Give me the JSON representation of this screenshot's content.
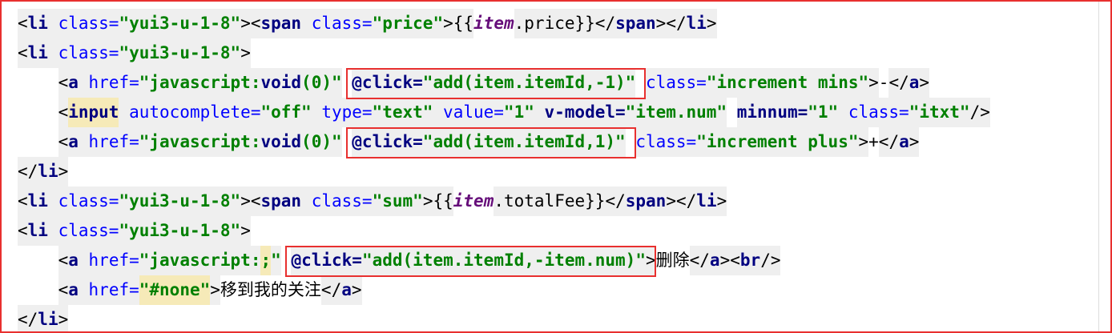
{
  "lines": [
    {
      "indent": "",
      "tokens": [
        {
          "t": "<",
          "c": "tok-punct"
        },
        {
          "t": "li",
          "c": "tok-tag"
        },
        {
          "t": " class=",
          "c": "tok-attr"
        },
        {
          "t": "\"yui3-u-1-8\"",
          "c": "tok-str"
        },
        {
          "t": ">",
          "c": "tok-punct"
        },
        {
          "t": "<",
          "c": "tok-punct"
        },
        {
          "t": "span",
          "c": "tok-tag"
        },
        {
          "t": " class=",
          "c": "tok-attr"
        },
        {
          "t": "\"price\"",
          "c": "tok-str"
        },
        {
          "t": ">",
          "c": "tok-punct"
        },
        {
          "t": "{{",
          "c": "tok-mustache"
        },
        {
          "t": "item",
          "c": "tok-italic"
        },
        {
          "t": ".price",
          "c": "tok-mustache"
        },
        {
          "t": "}}",
          "c": "tok-mustache"
        },
        {
          "t": "</",
          "c": "tok-punct"
        },
        {
          "t": "span",
          "c": "tok-tag"
        },
        {
          "t": ">",
          "c": "tok-punct"
        },
        {
          "t": "</",
          "c": "tok-punct"
        },
        {
          "t": "li",
          "c": "tok-tag"
        },
        {
          "t": ">",
          "c": "tok-punct"
        }
      ]
    },
    {
      "indent": "",
      "tokens": [
        {
          "t": "<",
          "c": "tok-punct"
        },
        {
          "t": "li",
          "c": "tok-tag"
        },
        {
          "t": " class=",
          "c": "tok-attr"
        },
        {
          "t": "\"yui3-u-1-8\"",
          "c": "tok-str"
        },
        {
          "t": ">",
          "c": "tok-punct"
        }
      ]
    },
    {
      "indent": "    ",
      "tokens": [
        {
          "t": "<",
          "c": "tok-punct"
        },
        {
          "t": "a",
          "c": "tok-tag"
        },
        {
          "t": " href=",
          "c": "tok-attr"
        },
        {
          "t": "\"javascript:",
          "c": "tok-str"
        },
        {
          "t": "void",
          "c": "tok-vue"
        },
        {
          "t": "(0)\"",
          "c": "tok-str"
        },
        {
          "t": " ",
          "c": "tok-text"
        },
        {
          "t": "@click=",
          "c": "tok-vue"
        },
        {
          "t": "\"add(item.itemId,-1)\"",
          "c": "tok-str"
        },
        {
          "t": " ",
          "c": "tok-text"
        },
        {
          "t": "class=",
          "c": "tok-attr"
        },
        {
          "t": "\"increment mins\"",
          "c": "tok-str"
        },
        {
          "t": ">",
          "c": "tok-punct"
        },
        {
          "t": "-",
          "c": "tok-text"
        },
        {
          "t": "</",
          "c": "tok-punct"
        },
        {
          "t": "a",
          "c": "tok-tag"
        },
        {
          "t": ">",
          "c": "tok-punct"
        }
      ]
    },
    {
      "indent": "    ",
      "tokens": [
        {
          "t": "<",
          "c": "tok-punct"
        },
        {
          "t": "input",
          "c": "tok-tag tok-hl"
        },
        {
          "t": " autocomplete=",
          "c": "tok-attr"
        },
        {
          "t": "\"off\"",
          "c": "tok-str"
        },
        {
          "t": " type=",
          "c": "tok-attr"
        },
        {
          "t": "\"text\"",
          "c": "tok-str"
        },
        {
          "t": " value=",
          "c": "tok-attr"
        },
        {
          "t": "\"1\"",
          "c": "tok-str"
        },
        {
          "t": " v-model=",
          "c": "tok-vue"
        },
        {
          "t": "\"item.num\"",
          "c": "tok-str"
        },
        {
          "t": " ",
          "c": "tok-text"
        },
        {
          "t": "minnum=",
          "c": "tok-vue"
        },
        {
          "t": "\"1\"",
          "c": "tok-str"
        },
        {
          "t": " class=",
          "c": "tok-attr"
        },
        {
          "t": "\"itxt\"",
          "c": "tok-str"
        },
        {
          "t": "/>",
          "c": "tok-punct"
        }
      ]
    },
    {
      "indent": "    ",
      "tokens": [
        {
          "t": "<",
          "c": "tok-punct"
        },
        {
          "t": "a",
          "c": "tok-tag"
        },
        {
          "t": " href=",
          "c": "tok-attr"
        },
        {
          "t": "\"javascript:",
          "c": "tok-str"
        },
        {
          "t": "void",
          "c": "tok-vue"
        },
        {
          "t": "(0)\"",
          "c": "tok-str"
        },
        {
          "t": " ",
          "c": "tok-text"
        },
        {
          "t": "@click=",
          "c": "tok-vue"
        },
        {
          "t": "\"add(item.itemId,1)\"",
          "c": "tok-str"
        },
        {
          "t": " ",
          "c": "tok-text"
        },
        {
          "t": "class=",
          "c": "tok-attr"
        },
        {
          "t": "\"increment plus\"",
          "c": "tok-str"
        },
        {
          "t": ">",
          "c": "tok-punct"
        },
        {
          "t": "+",
          "c": "tok-text"
        },
        {
          "t": "</",
          "c": "tok-punct"
        },
        {
          "t": "a",
          "c": "tok-tag"
        },
        {
          "t": ">",
          "c": "tok-punct"
        }
      ]
    },
    {
      "indent": "",
      "tokens": [
        {
          "t": "</",
          "c": "tok-punct"
        },
        {
          "t": "li",
          "c": "tok-tag"
        },
        {
          "t": ">",
          "c": "tok-punct"
        }
      ]
    },
    {
      "indent": "",
      "tokens": [
        {
          "t": "<",
          "c": "tok-punct"
        },
        {
          "t": "li",
          "c": "tok-tag"
        },
        {
          "t": " class=",
          "c": "tok-attr"
        },
        {
          "t": "\"yui3-u-1-8\"",
          "c": "tok-str"
        },
        {
          "t": ">",
          "c": "tok-punct"
        },
        {
          "t": "<",
          "c": "tok-punct"
        },
        {
          "t": "span",
          "c": "tok-tag"
        },
        {
          "t": " class=",
          "c": "tok-attr"
        },
        {
          "t": "\"sum\"",
          "c": "tok-str"
        },
        {
          "t": ">",
          "c": "tok-punct"
        },
        {
          "t": "{{",
          "c": "tok-mustache"
        },
        {
          "t": "item",
          "c": "tok-italic"
        },
        {
          "t": ".totalFee",
          "c": "tok-mustache"
        },
        {
          "t": "}}",
          "c": "tok-mustache"
        },
        {
          "t": "</",
          "c": "tok-punct"
        },
        {
          "t": "span",
          "c": "tok-tag"
        },
        {
          "t": ">",
          "c": "tok-punct"
        },
        {
          "t": "</",
          "c": "tok-punct"
        },
        {
          "t": "li",
          "c": "tok-tag"
        },
        {
          "t": ">",
          "c": "tok-punct"
        }
      ]
    },
    {
      "indent": "",
      "tokens": [
        {
          "t": "<",
          "c": "tok-punct"
        },
        {
          "t": "li",
          "c": "tok-tag"
        },
        {
          "t": " class=",
          "c": "tok-attr"
        },
        {
          "t": "\"yui3-u-1-8\"",
          "c": "tok-str"
        },
        {
          "t": ">",
          "c": "tok-punct"
        }
      ]
    },
    {
      "indent": "    ",
      "tokens": [
        {
          "t": "<",
          "c": "tok-punct"
        },
        {
          "t": "a",
          "c": "tok-tag"
        },
        {
          "t": " href=",
          "c": "tok-attr"
        },
        {
          "t": "\"javascript:",
          "c": "tok-str"
        },
        {
          "t": ";",
          "c": "tok-str tok-hl"
        },
        {
          "t": "\"",
          "c": "tok-str"
        },
        {
          "t": " ",
          "c": "tok-text"
        },
        {
          "t": "@click=",
          "c": "tok-vue"
        },
        {
          "t": "\"add(item.itemId,-item.num)\"",
          "c": "tok-str"
        },
        {
          "t": ">",
          "c": "tok-punct"
        },
        {
          "t": "删除",
          "c": "tok-text"
        },
        {
          "t": "</",
          "c": "tok-punct"
        },
        {
          "t": "a",
          "c": "tok-tag"
        },
        {
          "t": ">",
          "c": "tok-punct"
        },
        {
          "t": "<",
          "c": "tok-punct"
        },
        {
          "t": "br",
          "c": "tok-tag"
        },
        {
          "t": "/>",
          "c": "tok-punct"
        }
      ]
    },
    {
      "indent": "    ",
      "tokens": [
        {
          "t": "<",
          "c": "tok-punct"
        },
        {
          "t": "a",
          "c": "tok-tag"
        },
        {
          "t": " href=",
          "c": "tok-attr"
        },
        {
          "t": "\"#none\"",
          "c": "tok-str tok-hl"
        },
        {
          "t": ">",
          "c": "tok-punct"
        },
        {
          "t": "移到我的关注",
          "c": "tok-text"
        },
        {
          "t": "</",
          "c": "tok-punct"
        },
        {
          "t": "a",
          "c": "tok-tag"
        },
        {
          "t": ">",
          "c": "tok-punct"
        }
      ]
    },
    {
      "indent": "",
      "tokens": [
        {
          "t": "</",
          "c": "tok-punct"
        },
        {
          "t": "li",
          "c": "tok-tag"
        },
        {
          "t": ">",
          "c": "tok-punct"
        }
      ]
    }
  ],
  "highlights": [
    {
      "line": 2,
      "from_token": 7,
      "to_token": 8
    },
    {
      "line": 4,
      "from_token": 7,
      "to_token": 8
    },
    {
      "line": 8,
      "from_token": 7,
      "to_token": 8
    }
  ],
  "colors": {
    "accent_border": "#e8302f"
  }
}
